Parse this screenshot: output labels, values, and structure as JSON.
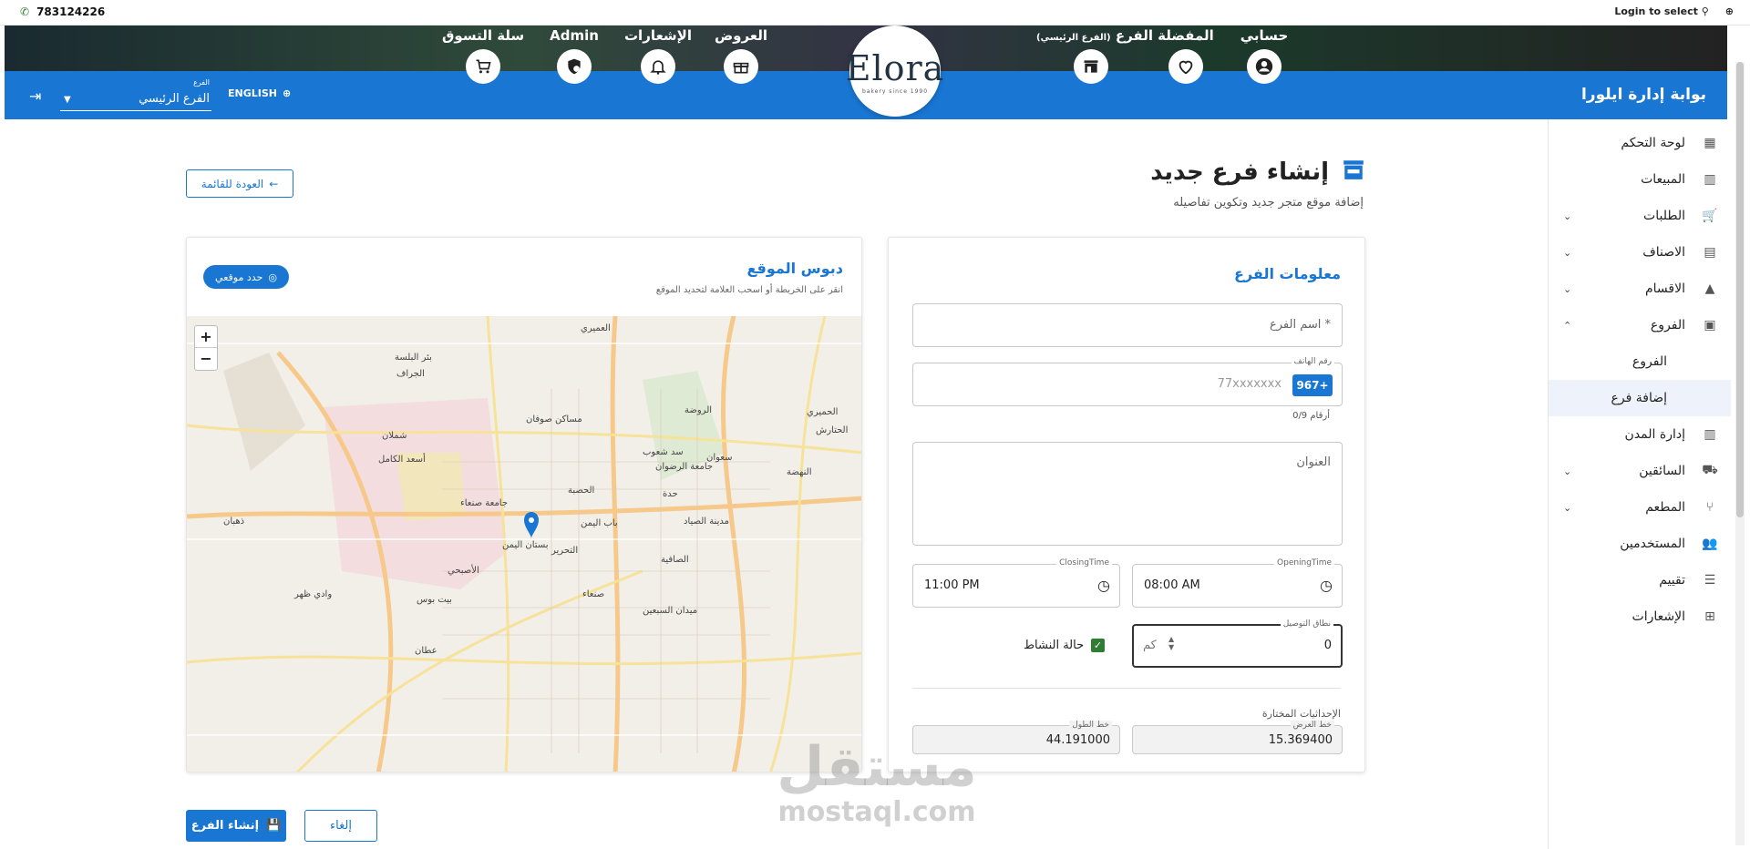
{
  "topbar": {
    "phone": "783124226",
    "login_select": "Login to select"
  },
  "nav": {
    "items": [
      {
        "label": "حسابي",
        "icon": "account-icon"
      },
      {
        "label": "المفضلة",
        "icon": "heart-icon"
      },
      {
        "label": "الفرع",
        "sub": "(الفرع الرئيسي)",
        "icon": "store-icon"
      },
      {
        "label": "العروض",
        "icon": "gift-icon"
      },
      {
        "label": "الإشعارات",
        "icon": "bell-icon"
      },
      {
        "label": "Admin",
        "icon": "admin-icon"
      },
      {
        "label": "سلة التسوق",
        "icon": "cart-icon"
      }
    ]
  },
  "logo": {
    "word": "Elora",
    "sub": "bakery since 1990"
  },
  "header": {
    "portal_title": "بوابة إدارة ايلورا",
    "language": "ENGLISH",
    "branch_caption": "الفرع",
    "branch_value": "الفرع الرئيسي"
  },
  "sidebar": {
    "items": [
      {
        "label": "لوحة التحكم"
      },
      {
        "label": "المبيعات"
      },
      {
        "label": "الطلبات"
      },
      {
        "label": "الاصناف"
      },
      {
        "label": "الاقسام"
      },
      {
        "label": "الفروع"
      },
      {
        "label": "الفروع"
      },
      {
        "label": "إضافة فرع"
      },
      {
        "label": "إدارة المدن"
      },
      {
        "label": "السائقين"
      },
      {
        "label": "المطعم"
      },
      {
        "label": "المستخدمين"
      },
      {
        "label": "تقييم"
      },
      {
        "label": "الإشعارات"
      }
    ]
  },
  "page": {
    "title": "إنشاء فرع جديد",
    "subtitle": "إضافة موقع متجر جديد وتكوين تفاصيله",
    "back_label": "العودة للقائمة"
  },
  "form": {
    "title": "معلومات الفرع",
    "name_placeholder": "اسم الفرع *",
    "phone_caption": "رقم الهاتف",
    "phone_placeholder": "77xxxxxxx",
    "phone_code": "967+",
    "phone_hint": "0/9 أرقام",
    "address_placeholder": "العنوان",
    "opening_caption": "OpeningTime",
    "opening_value": "08:00 AM",
    "closing_caption": "ClosingTime",
    "closing_value": "11:00 PM",
    "delivery_caption": "نطاق التوصيل",
    "delivery_value": "0",
    "delivery_unit": "كم",
    "active_label": "حالة النشاط",
    "coords_title": "الإحداثيات المختارة",
    "lat_caption": "خط العرض",
    "lat_value": "15.369400",
    "lng_caption": "خط الطول",
    "lng_value": "44.191000"
  },
  "map": {
    "title": "دبوس الموقع",
    "subtitle": "انقر على الخريطة أو اسحب العلامة لتحديد الموقع",
    "locate_label": "حدد موقعي",
    "labels": [
      "بئر البلسة",
      "العميري",
      "مساكن صوفان",
      "جامعة الرضوان",
      "سد شعوب",
      "الحميري",
      "صنعاء",
      "باب اليمن",
      "التحرير",
      "حدة",
      "شملان",
      "أسعد الكامل",
      "الحصبة",
      "مدينة الصياد",
      "ميدان السبعين",
      "الصافية",
      "جامعة صنعاء",
      "سعوان",
      "الجراف",
      "وادي ظهر",
      "النهضة",
      "بيت بوس",
      "ذهبان",
      "الأصبحي",
      "عطان",
      "بستان اليمن",
      "الروضة",
      "الحتارش"
    ]
  },
  "actions": {
    "create_label": "إنشاء الفرع",
    "cancel_label": "إلغاء"
  },
  "watermark": {
    "ar": "مستقل",
    "en": "mostaql.com"
  }
}
